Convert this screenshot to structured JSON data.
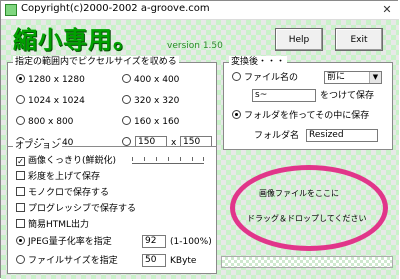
{
  "window": {
    "title": "Copyright(c)2000-2002 a-groove.com",
    "close_glyph": "✕"
  },
  "header": {
    "app_title": "縮小専用。",
    "version": "version 1.50"
  },
  "buttons": {
    "help": "Help",
    "exit": "Exit"
  },
  "size_group": {
    "legend": "指定の範囲内でピクセルサイズを収める",
    "options": [
      "1280 x 1280",
      "400 x 400",
      "1024 x 1024",
      "320 x 320",
      "800 x 800",
      "160 x 160",
      "640 x 640"
    ],
    "selected": "1280 x 1280",
    "custom_width": "150",
    "custom_x": "x",
    "custom_height": "150"
  },
  "save_group": {
    "legend": "変換後・・・",
    "filename_option": "ファイル名の",
    "prefix_select": "前に",
    "prefix_value": "s~",
    "attach_label": "をつけて保存",
    "folder_option": "フォルダを作ってその中に保存",
    "selected": "folder",
    "folder_label": "フォルダ名",
    "folder_value": "Resized"
  },
  "options_group": {
    "legend": "オプション",
    "sharpen": "画像くっきり(鮮鋭化)",
    "saturation": "彩度を上げて保存",
    "monochrome": "モノクロで保存する",
    "progressive": "プログレッシブで保存する",
    "simple_html": "簡易HTML出力",
    "jpeg_quality": "JPEG量子化率を指定",
    "jpeg_value": "92",
    "jpeg_range": "(1-100%)",
    "filesize": "ファイルサイズを指定",
    "filesize_value": "50",
    "filesize_unit": "KByte",
    "checked": [
      "sharpen"
    ],
    "selected_radio": "jpeg_quality"
  },
  "drop_area": {
    "line1": "画像ファイルをここに",
    "line2": "ドラッグ＆ドロップしてください",
    "accent_color": "#e1358a"
  },
  "colors": {
    "title_green": "#00a000",
    "pattern_green": "#c9f2c9"
  }
}
